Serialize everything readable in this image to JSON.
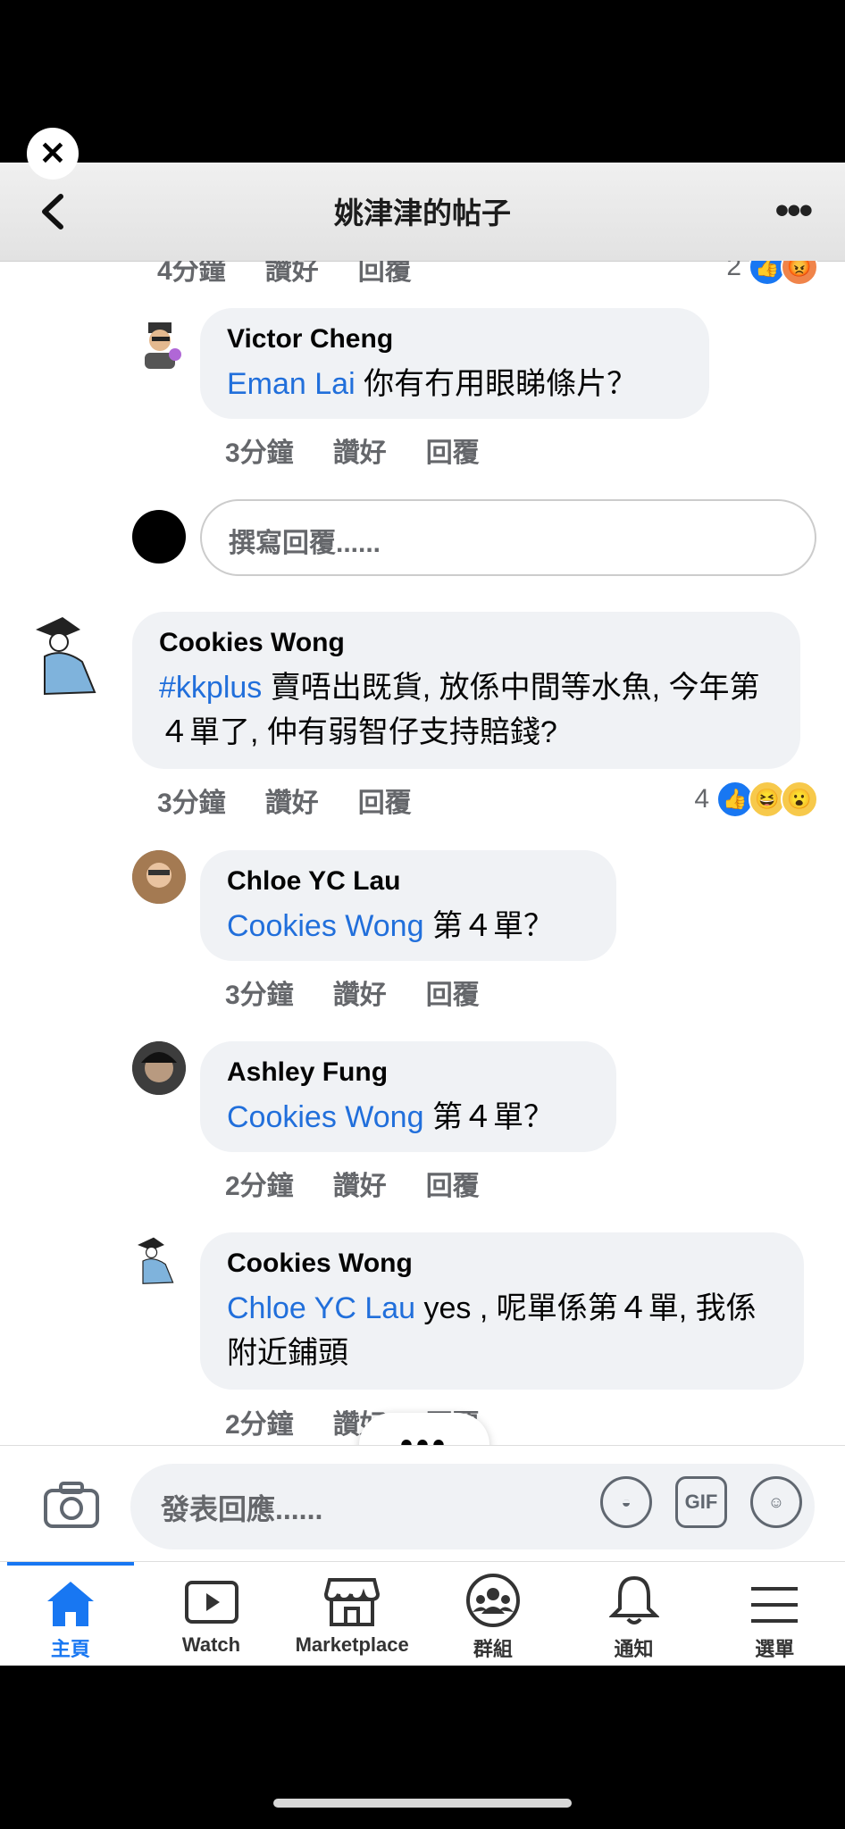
{
  "header": {
    "title": "姚津津的帖子"
  },
  "top_comment": {
    "meta": {
      "time": "4分鐘",
      "like": "讚好",
      "reply": "回覆"
    },
    "reaction_count": "2"
  },
  "comments": [
    {
      "author": "Victor Cheng",
      "mention": "Eman Lai",
      "text": " 你有冇用眼睇條片？",
      "time": "3分鐘",
      "like": "讚好",
      "reply": "回覆"
    },
    {
      "author": "Cookies Wong",
      "mention": "#kkplus",
      "text": " 賣唔出既貨, 放係中間等水魚, 今年第４單了, 仲有弱智仔支持賠錢?",
      "time": "3分鐘",
      "like": "讚好",
      "reply": "回覆",
      "reaction_count": "4"
    },
    {
      "author": "Chloe YC Lau",
      "mention": "Cookies Wong",
      "text": " 第４單？",
      "time": "3分鐘",
      "like": "讚好",
      "reply": "回覆"
    },
    {
      "author": "Ashley Fung",
      "mention": "Cookies Wong",
      "text": " 第４單？",
      "time": "2分鐘",
      "like": "讚好",
      "reply": "回覆"
    },
    {
      "author": "Cookies Wong",
      "mention": "Chloe YC Lau",
      "text": " yes , 呢單係第４單, 我係附近鋪頭",
      "time": "2分鐘",
      "like": "讚好",
      "reply": "回覆"
    }
  ],
  "reply_box": {
    "placeholder": "撰寫回覆......"
  },
  "composer": {
    "placeholder": "發表回應......",
    "gif_label": "GIF"
  },
  "tabs": [
    {
      "label": "主頁",
      "icon": "home-icon",
      "active": true
    },
    {
      "label": "Watch",
      "icon": "watch-icon"
    },
    {
      "label": "Marketplace",
      "icon": "marketplace-icon"
    },
    {
      "label": "群組",
      "icon": "groups-icon"
    },
    {
      "label": "通知",
      "icon": "bell-icon"
    },
    {
      "label": "選單",
      "icon": "menu-icon"
    }
  ],
  "colors": {
    "accent": "#1877f2",
    "mention": "#216fdb",
    "bubble": "#f0f2f5"
  }
}
